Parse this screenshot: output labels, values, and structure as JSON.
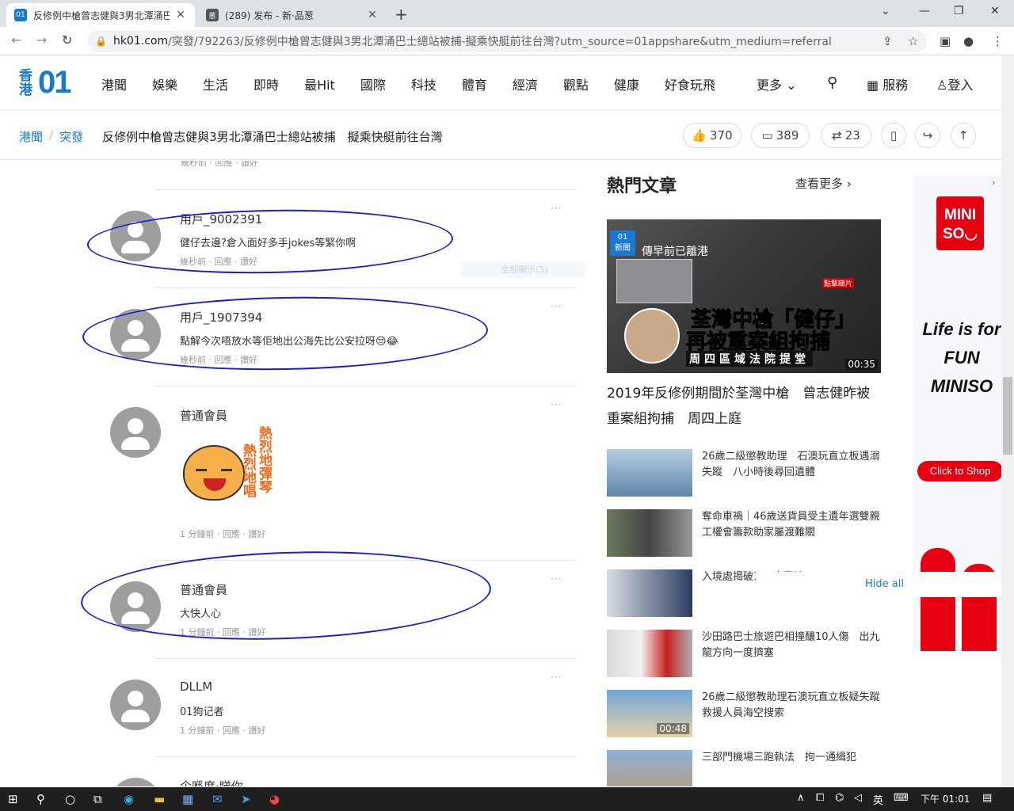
{
  "browser": {
    "tabs": [
      {
        "title": "反修例中槍曾志健與3男北潭涌巴",
        "favicon": "01"
      },
      {
        "title": "(289) 发布 - 新·品葱",
        "favicon": "葱"
      }
    ],
    "url_host": "hk01.com",
    "url_path": "/突發/792263/反修例中槍曾志健與3男北潭涌巴士總站被捕-擬乘快艇前往台灣?utm_source=01appshare&utm_medium=referral"
  },
  "site": {
    "logo_hk": "香港",
    "logo_01": "01",
    "nav": [
      "港聞",
      "娛樂",
      "生活",
      "即時",
      "最Hit",
      "國際",
      "科技",
      "體育",
      "經濟",
      "觀點",
      "健康",
      "好食玩飛"
    ],
    "more": "更多",
    "services": "服務",
    "login": "登入"
  },
  "breadcrumb": {
    "section": "港聞",
    "sub": "突發",
    "title": "反修例中槍曾志健與3男北潭涌巴士總站被捕　擬乘快艇前往台灣"
  },
  "stats": {
    "likes": "370",
    "comments": "389",
    "shares": "23"
  },
  "comments_top_meta": "幾秒前 · 回應 · 讚好",
  "show_all": "全部顯示(5)",
  "comments": [
    {
      "user": "用戶_9002391",
      "text": "健仔去邊?倉入面好多手jokes等緊你啊",
      "meta": "幾秒前 · 回應 · 讚好"
    },
    {
      "user": "用戶_1907394",
      "text": "點解今次唔放水等佢地出公海先比公安拉呀😒😂",
      "meta": "幾秒前 · 回應 · 讚好"
    },
    {
      "user": "普通會員",
      "text": "",
      "sticker": [
        "熱烈地彈琴",
        "熱烈地唱"
      ],
      "meta": "1 分鐘前 · 回應 · 讚好"
    },
    {
      "user": "普通會員",
      "text": "大快人心",
      "meta": "1 分鐘前 · 回應 · 讚好"
    },
    {
      "user": "DLLM",
      "text": "01狗记者",
      "meta": "1 分鐘前 · 回應 · 讚好"
    },
    {
      "user": "企喺度·睇你",
      "text": "",
      "meta": ""
    }
  ],
  "sidebar": {
    "heading": "熱門文章",
    "see_more": "查看更多",
    "featured": {
      "badge": "新聞",
      "overlay1": "傳早前已離港",
      "overlay2": "荃灣中槍「健仔」",
      "overlay3": "再被重案組拘捕",
      "overlay4": "周四區域法院提堂",
      "click": "點擊睇片",
      "duration": "00:35",
      "caption": "2019年反修例期間於荃灣中槍　曾志健昨被重案組拘捕　周四上庭"
    },
    "articles": [
      {
        "text": "26歲二級懲教助理　石澳玩直立板遇溺失蹤　八小時後尋回遺體",
        "duration": ""
      },
      {
        "text": "奪命車禍｜46歲送貨員受主遺年選雙親　工權會籌款助家屬渡難關",
        "duration": ""
      },
      {
        "text": "入境處揭破150宗案涉",
        "duration": ""
      },
      {
        "text": "沙田路巴士旅遊巴相撞釀10人傷　出九龍方向一度擠塞",
        "duration": ""
      },
      {
        "text": "26歲二級懲教助理石澳玩直立板疑失蹤　救援人員海空搜索",
        "duration": "00:48"
      },
      {
        "text": "三部門機場三跑執法　拘一通緝犯",
        "duration": ""
      }
    ]
  },
  "ad": {
    "brand_line1": "MINI",
    "brand_line2": "SO",
    "slogan": [
      "Life is for",
      "FUN",
      "MINISO"
    ],
    "cta": "Click to Shop",
    "hide_all": "Hide all"
  },
  "taskbar": {
    "ime": "英",
    "time": "下午 01:01"
  }
}
